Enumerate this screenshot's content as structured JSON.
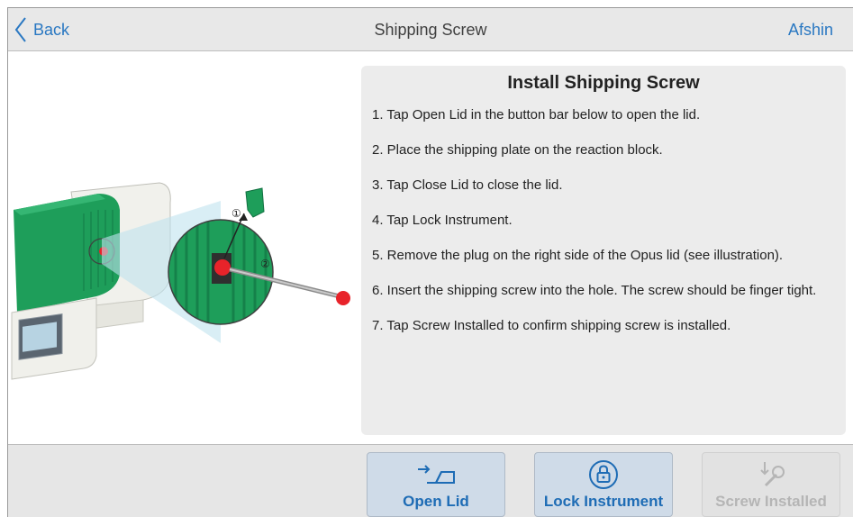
{
  "header": {
    "back_label": "Back",
    "title": "Shipping Screw",
    "user": "Afshin"
  },
  "illustration": {
    "callouts": [
      "①",
      "②"
    ]
  },
  "panel": {
    "title": "Install Shipping Screw",
    "steps": [
      "1. Tap Open Lid in the button bar below to open the lid.",
      "2. Place the shipping plate on the reaction block.",
      "3. Tap Close Lid to close the lid.",
      "4. Tap Lock Instrument.",
      "5. Remove the plug on the right side of the Opus lid (see illustration).",
      "6. Insert the shipping screw into the hole. The screw should be finger tight.",
      "7. Tap Screw Installed to confirm shipping screw is installed."
    ]
  },
  "footer": {
    "buttons": [
      {
        "label": "Open Lid",
        "icon": "open-lid-icon",
        "enabled": true
      },
      {
        "label": "Lock Instrument",
        "icon": "lock-icon",
        "enabled": true
      },
      {
        "label": "Screw Installed",
        "icon": "screw-icon",
        "enabled": false
      }
    ]
  },
  "colors": {
    "accent": "#2a78c2",
    "instrument_green": "#1e9e5a",
    "plug_red": "#e8232a",
    "button_bg": "#cfdbe8"
  }
}
